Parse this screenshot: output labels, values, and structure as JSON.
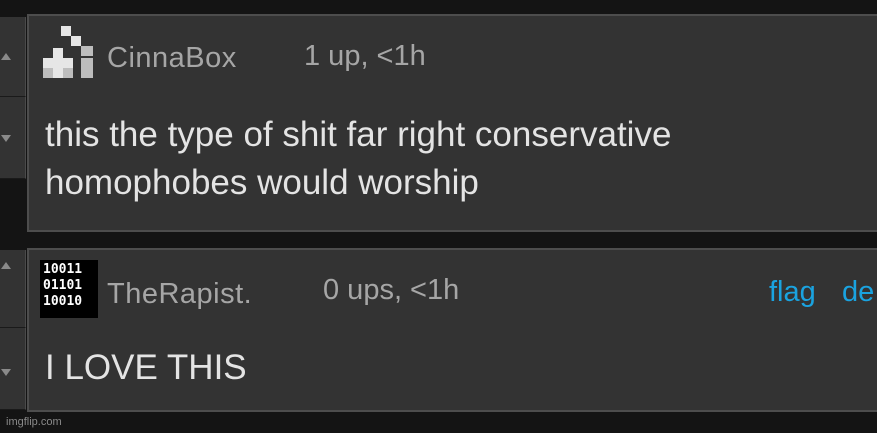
{
  "comments": [
    {
      "username": "CinnaBox",
      "meta": "1 up, <1h",
      "body_lines": [
        "this the type of shit far right conservative",
        "homophobes would worship"
      ],
      "avatar": "cinnabox-avatar"
    },
    {
      "username": "TheRapist.",
      "meta": "0 ups, <1h",
      "body_lines": [
        "I LOVE THIS"
      ],
      "avatar": "binary-avatar",
      "avatar_text": [
        "10011",
        "01101",
        "10010"
      ],
      "actions": {
        "flag": "flag",
        "delete": "de"
      }
    }
  ],
  "footer": "imgflip.com",
  "colors": {
    "background": "#141414",
    "card": "#333333",
    "border": "#4d4d4d",
    "link": "#1aa3e0",
    "text": "#e4e4e4",
    "muted": "#a6a6a6"
  }
}
